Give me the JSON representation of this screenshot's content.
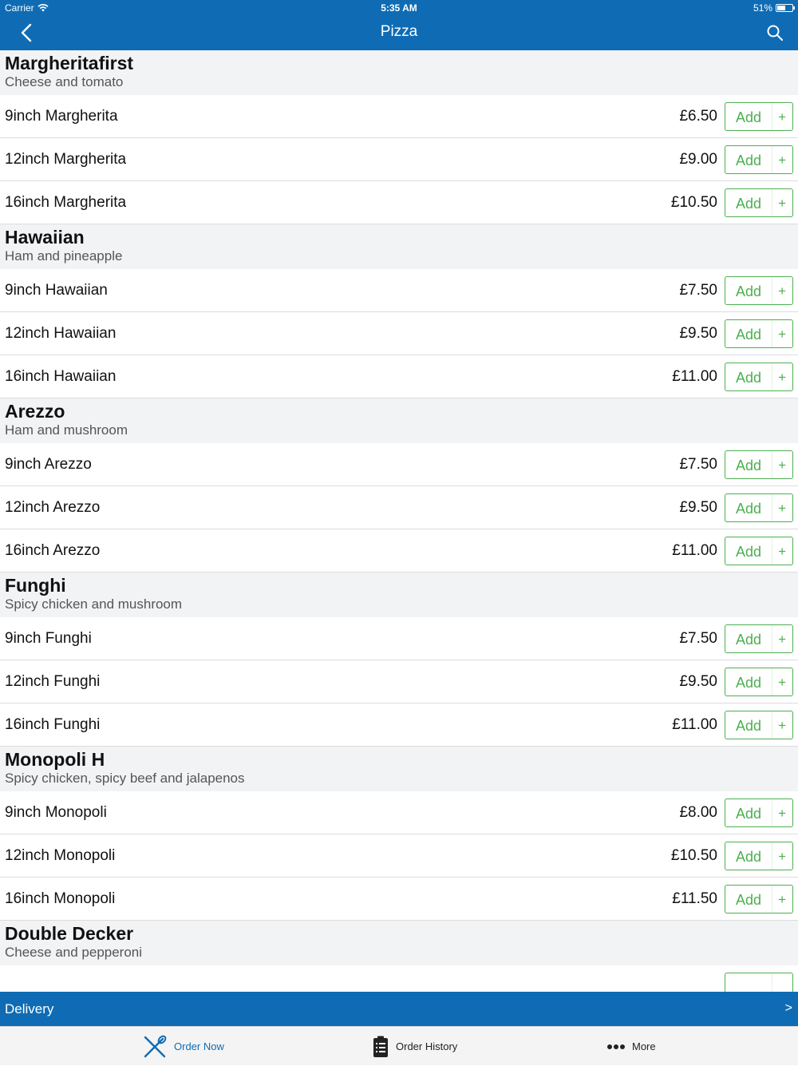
{
  "status": {
    "carrier": "Carrier",
    "time": "5:35 AM",
    "battery": "51%"
  },
  "nav": {
    "title": "Pizza"
  },
  "sections": [
    {
      "name": "Margheritafirst",
      "desc": "Cheese and tomato",
      "items": [
        {
          "name": "9inch Margherita",
          "price": "£6.50"
        },
        {
          "name": "12inch Margherita",
          "price": "£9.00"
        },
        {
          "name": "16inch Margherita",
          "price": "£10.50"
        }
      ]
    },
    {
      "name": "Hawaiian",
      "desc": "Ham and pineapple",
      "items": [
        {
          "name": "9inch Hawaiian",
          "price": "£7.50"
        },
        {
          "name": "12inch Hawaiian",
          "price": "£9.50"
        },
        {
          "name": "16inch Hawaiian",
          "price": "£11.00"
        }
      ]
    },
    {
      "name": "Arezzo",
      "desc": "Ham and mushroom",
      "items": [
        {
          "name": "9inch Arezzo",
          "price": "£7.50"
        },
        {
          "name": "12inch Arezzo",
          "price": "£9.50"
        },
        {
          "name": "16inch Arezzo",
          "price": "£11.00"
        }
      ]
    },
    {
      "name": "Funghi",
      "desc": "Spicy chicken and mushroom",
      "items": [
        {
          "name": "9inch Funghi",
          "price": "£7.50"
        },
        {
          "name": "12inch Funghi",
          "price": "£9.50"
        },
        {
          "name": "16inch Funghi",
          "price": "£11.00"
        }
      ]
    },
    {
      "name": "Monopoli H",
      "desc": "Spicy chicken, spicy beef and jalapenos",
      "items": [
        {
          "name": "9inch Monopoli",
          "price": "£8.00"
        },
        {
          "name": "12inch Monopoli",
          "price": "£10.50"
        },
        {
          "name": "16inch Monopoli",
          "price": "£11.50"
        }
      ]
    },
    {
      "name": "Double Decker",
      "desc": "Cheese and pepperoni",
      "items": []
    }
  ],
  "add_label": "Add",
  "add_plus": "+",
  "delivery": {
    "label": "Delivery",
    "chevron": ">"
  },
  "tabs": {
    "order_now": "Order Now",
    "order_history": "Order History",
    "more": "More"
  },
  "colors": {
    "primary": "#0f6cb4",
    "add_green": "#4caf50",
    "section_bg": "#f2f3f5"
  },
  "icons": {
    "back": "chevron-left-icon",
    "search": "search-icon",
    "order_now": "fork-knife-icon",
    "order_history": "clipboard-list-icon",
    "more": "ellipsis-icon"
  }
}
